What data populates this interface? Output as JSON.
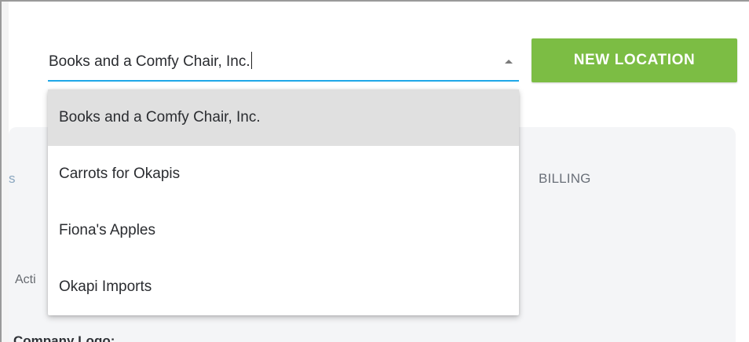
{
  "company_select": {
    "value": "Books and a Comfy Chair, Inc.",
    "options": [
      "Books and a Comfy Chair, Inc.",
      "Carrots for Okapis",
      "Fiona's Apples",
      "Okapi Imports"
    ]
  },
  "toolbar": {
    "new_location_label": "NEW LOCATION"
  },
  "tabs": {
    "billing_label": "BILLING",
    "left_partial": "s"
  },
  "content": {
    "active_label_partial": "Acti",
    "company_logo_label": "Company Logo:"
  },
  "colors": {
    "accent_underline": "#1ea7e8",
    "button_green": "#7cbd44",
    "highlight_row": "#e0e0e0"
  },
  "icons": {
    "dropdown_toggle": "arrow-up-icon"
  }
}
